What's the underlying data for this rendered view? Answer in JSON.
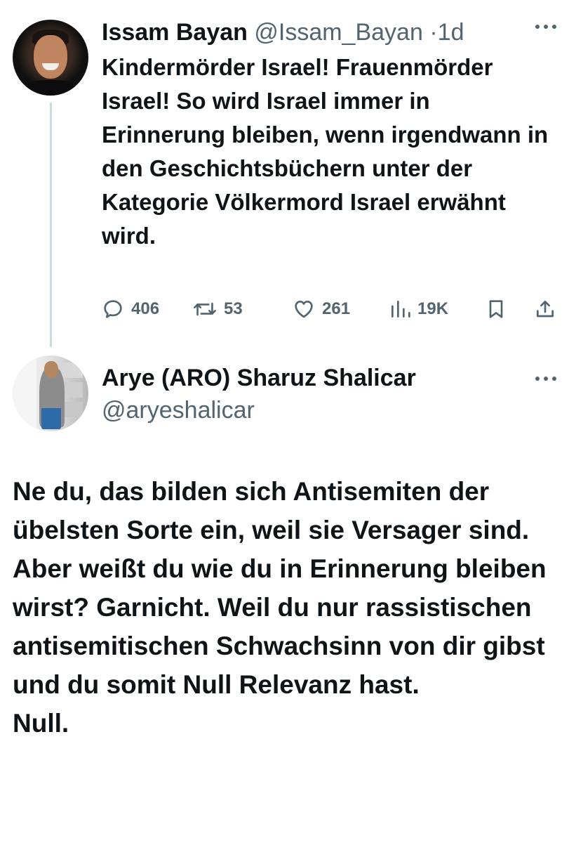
{
  "tweet": {
    "author_name": "Issam Bayan",
    "author_handle": "@Issam_Bayan",
    "separator": "·",
    "timestamp": "1d",
    "text": "Kindermörder Israel! Frauenmörder Israel! So wird Israel immer in Erinnerung bleiben, wenn irgendwann in den Geschichtsbüchern unter der Kategorie Völkermord Israel erwähnt wird.",
    "metrics": {
      "replies": "406",
      "retweets": "53",
      "likes": "261",
      "views": "19K"
    },
    "icons": {
      "more": "more-options-icon",
      "reply": "reply-icon",
      "retweet": "retweet-icon",
      "like": "heart-icon",
      "views": "analytics-icon",
      "bookmark": "bookmark-icon",
      "share": "share-icon"
    }
  },
  "reply": {
    "author_name": "Arye (ARO) Sharuz Shalicar",
    "author_handle": "@aryeshalicar",
    "text": "Ne du, das bilden sich Antisemiten der übelsten Sorte ein, weil sie Versager sind.\nAber weißt du wie du in Erinnerung bleiben wirst? Garnicht. Weil du nur rassistischen antisemitischen Schwachsinn von dir gibst und du somit Null Relevanz hast.\nNull.",
    "icons": {
      "more": "more-options-icon"
    }
  },
  "colors": {
    "text_primary": "#0f1419",
    "text_secondary": "#536471",
    "thread_line": "#cfd9de",
    "background": "#ffffff"
  }
}
